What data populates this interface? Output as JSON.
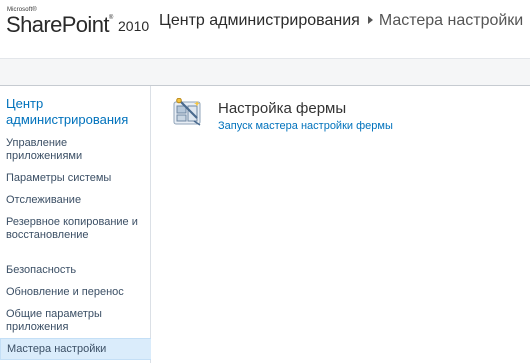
{
  "header": {
    "logo_microsoft": "Microsoft®",
    "logo_product": "SharePoint",
    "logo_trademark": "®",
    "logo_version": "2010",
    "breadcrumb": {
      "root": "Центр администрирования",
      "current": "Мастера настройки"
    }
  },
  "sidebar": {
    "header": "Центр администрирования",
    "items": [
      {
        "label": "Управление приложениями"
      },
      {
        "label": "Параметры системы"
      },
      {
        "label": "Отслеживание"
      },
      {
        "label": "Резервное копирование и восстановление"
      },
      {
        "label": "Безопасность"
      },
      {
        "label": "Обновление и перенос"
      },
      {
        "label": "Общие параметры приложения"
      },
      {
        "label": "Мастера настройки",
        "selected": true
      }
    ]
  },
  "main": {
    "section_title": "Настройка фермы",
    "section_link": "Запуск мастера настройки фермы",
    "icon": "farm-wizard-icon"
  },
  "colors": {
    "link": "#0072bc",
    "nav_text": "#3b4f65",
    "selected_bg": "#daecfb"
  }
}
